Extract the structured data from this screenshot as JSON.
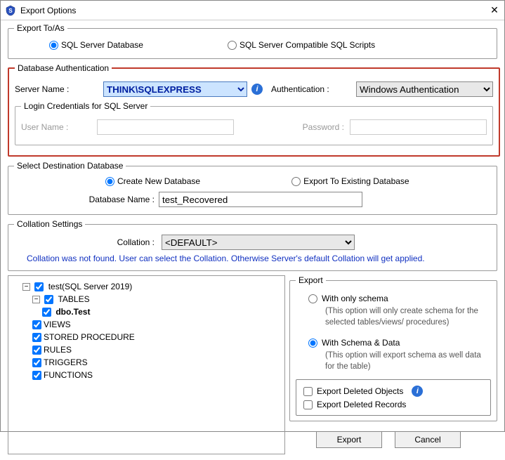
{
  "window": {
    "title": "Export Options"
  },
  "exportTo": {
    "legend": "Export To/As",
    "options": {
      "db": "SQL Server Database",
      "scripts": "SQL Server Compatible SQL Scripts"
    }
  },
  "dbAuth": {
    "legend": "Database Authentication",
    "serverNameLabel": "Server Name :",
    "serverName": "THINK\\SQLEXPRESS",
    "authLabel": "Authentication :",
    "authValue": "Windows Authentication",
    "login": {
      "legend": "Login Credentials for SQL Server",
      "userLabel": "User Name :",
      "userValue": "",
      "passLabel": "Password :",
      "passValue": ""
    }
  },
  "destDb": {
    "legend": "Select Destination Database",
    "createNew": "Create New Database",
    "exportExisting": "Export To Existing Database",
    "dbNameLabel": "Database Name :",
    "dbName": "test_Recovered"
  },
  "collation": {
    "legend": "Collation Settings",
    "label": "Collation :",
    "value": "<DEFAULT>",
    "note": "Collation was not found. User can select the Collation. Otherwise Server's default Collation will get applied."
  },
  "tree": {
    "root": "test(SQL Server 2019)",
    "nodes": {
      "tables": "TABLES",
      "dboTest": "dbo.Test",
      "views": "VIEWS",
      "sp": "STORED PROCEDURE",
      "rules": "RULES",
      "triggers": "TRIGGERS",
      "functions": "FUNCTIONS"
    }
  },
  "exportOpt": {
    "legend": "Export",
    "schemaOnly": "With only schema",
    "schemaOnlyDesc": "(This option will only create schema for the  selected tables/views/ procedures)",
    "schemaData": "With Schema & Data",
    "schemaDataDesc": "(This option will export schema as well data for the table)",
    "deletedObjects": "Export Deleted Objects",
    "deletedRecords": "Export Deleted Records"
  },
  "buttons": {
    "export": "Export",
    "cancel": "Cancel"
  }
}
